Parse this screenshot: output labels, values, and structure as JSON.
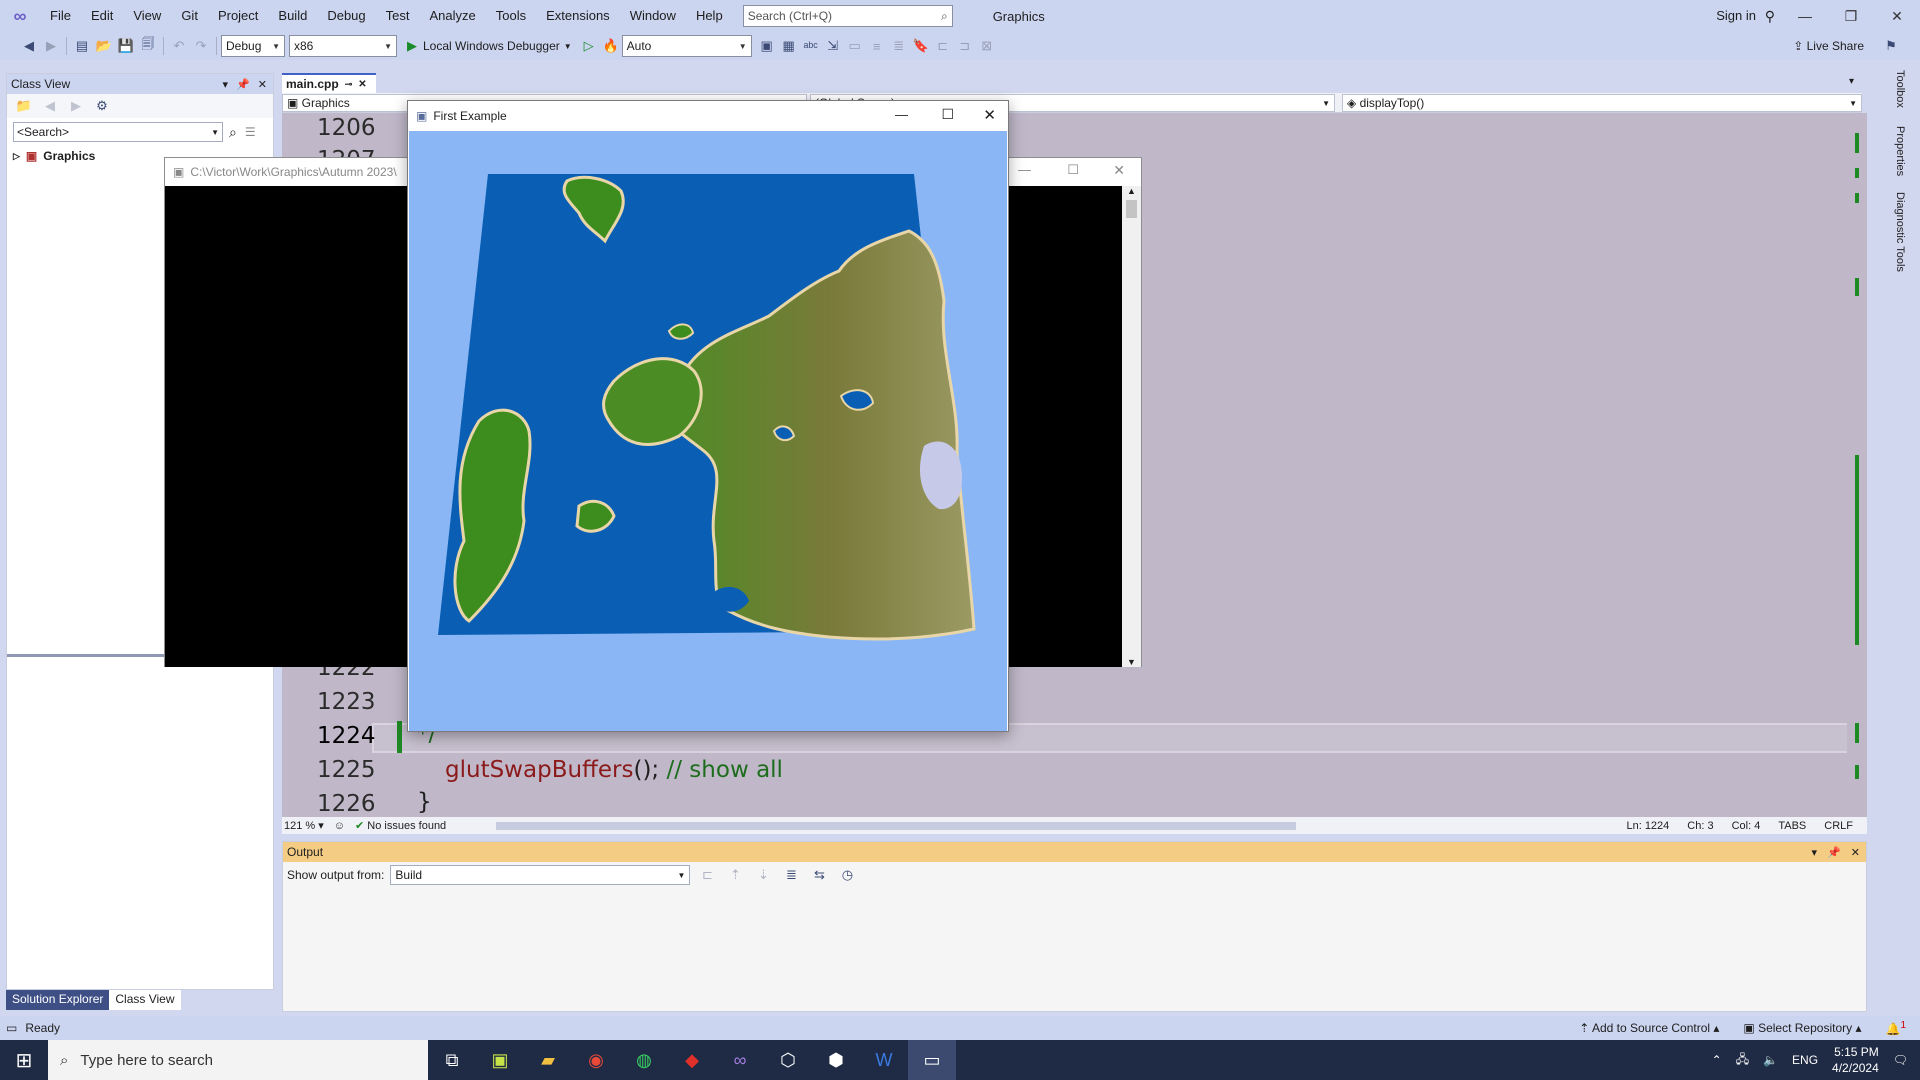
{
  "menubar": {
    "items": [
      "File",
      "Edit",
      "View",
      "Git",
      "Project",
      "Build",
      "Debug",
      "Test",
      "Analyze",
      "Tools",
      "Extensions",
      "Window",
      "Help"
    ],
    "search_placeholder": "Search (Ctrl+Q)",
    "solution_name": "Graphics",
    "sign_in": "Sign in"
  },
  "toolbar": {
    "config": "Debug",
    "platform": "x86",
    "debugger": "Local Windows Debugger",
    "auto": "Auto",
    "live_share": "Live Share"
  },
  "classview": {
    "title": "Class View",
    "search": "<Search>",
    "tree_item": "Graphics"
  },
  "bottom_tabs": [
    "Solution Explorer",
    "Class View"
  ],
  "editor": {
    "tab": "main.cpp",
    "nav_project": "Graphics",
    "nav_scope": "(Global Scope)",
    "nav_func": "displayTop()",
    "lines": [
      {
        "num": "1206",
        "text": ""
      },
      {
        "num": "1207",
        "text": ""
      },
      {
        "num": "1222",
        "text": ""
      },
      {
        "num": "1223",
        "text": ""
      },
      {
        "num": "1224",
        "text": "*/"
      },
      {
        "num": "1225",
        "text": "glutSwapBuffers(); // show all"
      },
      {
        "num": "1226",
        "text": "}"
      }
    ],
    "code_call": "glutSwapBuffers",
    "code_rest": "(); ",
    "code_comment": "// show all",
    "zoom": "121 %",
    "issues": "No issues found",
    "ln": "Ln: 1224",
    "ch": "Ch: 3",
    "col": "Col: 4",
    "tabs": "TABS",
    "eol": "CRLF"
  },
  "output": {
    "title": "Output",
    "show_from_label": "Show output from:",
    "source": "Build"
  },
  "side_tabs": [
    "Toolbox",
    "Properties",
    "Diagnostic Tools"
  ],
  "console": {
    "title": "C:\\Victor\\Work\\Graphics\\Autumn 2023\\"
  },
  "glwindow": {
    "title": "First Example"
  },
  "statusbar": {
    "ready": "Ready",
    "source_control": "Add to Source Control",
    "repo": "Select Repository",
    "notifications": "1"
  },
  "taskbar": {
    "search_placeholder": "Type here to search",
    "lang": "ENG",
    "time": "5:15 PM",
    "date": "4/2/2024"
  },
  "colors": {
    "water": "#0a5fb4",
    "sky": "#8ab6f5",
    "grass": "#3c8c1e",
    "beach": "#e8d6a8",
    "mountain": "#7d7a3c",
    "snow": "#c7c9e8",
    "output_header": "#f5cc84",
    "code_bg": "#c0b8c9"
  }
}
